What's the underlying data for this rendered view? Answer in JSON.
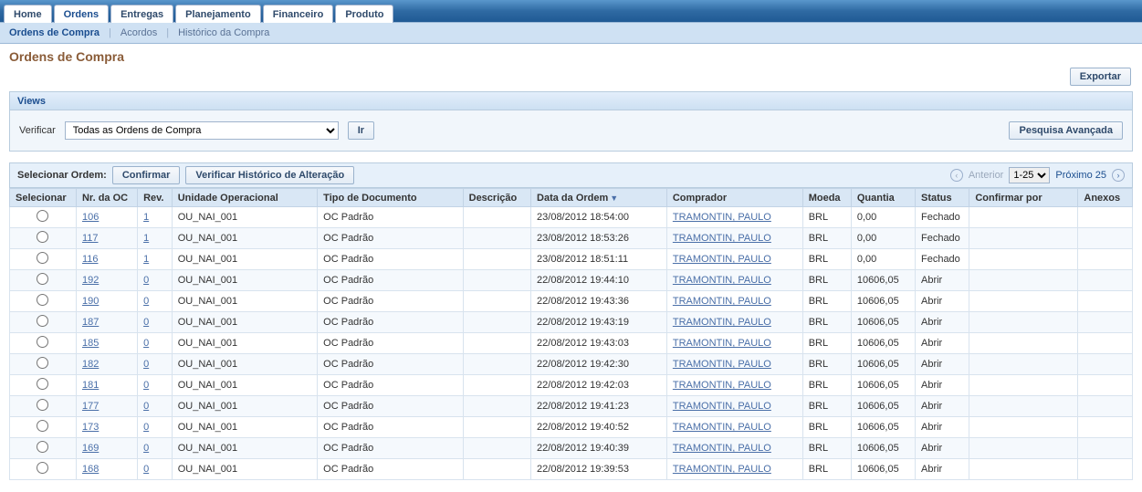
{
  "topTabs": [
    "Home",
    "Ordens",
    "Entregas",
    "Planejamento",
    "Financeiro",
    "Produto"
  ],
  "activeTab": 1,
  "subnav": {
    "current": "Ordens de Compra",
    "links": [
      "Acordos",
      "Histórico da Compra"
    ]
  },
  "pageTitle": "Ordens de Compra",
  "buttons": {
    "export": "Exportar",
    "go": "Ir",
    "advSearch": "Pesquisa Avançada",
    "confirm": "Confirmar",
    "histChange": "Verificar Histórico de Alteração"
  },
  "labels": {
    "views": "Views",
    "verify": "Verificar",
    "selectOrder": "Selecionar Ordem:",
    "prev": "Anterior",
    "next": "Próximo 25",
    "pageRange": "1-25"
  },
  "dropdown": {
    "selected": "Todas as Ordens de Compra"
  },
  "columns": {
    "selecionar": "Selecionar",
    "nrOc": "Nr. da OC",
    "rev": "Rev.",
    "unidade": "Unidade Operacional",
    "tipoDoc": "Tipo de Documento",
    "descricao": "Descrição",
    "dataOrdem": "Data da Ordem",
    "comprador": "Comprador",
    "moeda": "Moeda",
    "quantia": "Quantia",
    "status": "Status",
    "confirmarPor": "Confirmar por",
    "anexos": "Anexos"
  },
  "sortedCol": "dataOrdem",
  "rows": [
    {
      "oc": "106",
      "rev": "1",
      "unid": "OU_NAI_001",
      "tipo": "OC Padrão",
      "desc": "",
      "data": "23/08/2012 18:54:00",
      "comp": "TRAMONTIN, PAULO",
      "moeda": "BRL",
      "qtd": "0,00",
      "status": "Fechado",
      "conf": "",
      "anex": ""
    },
    {
      "oc": "117",
      "rev": "1",
      "unid": "OU_NAI_001",
      "tipo": "OC Padrão",
      "desc": "",
      "data": "23/08/2012 18:53:26",
      "comp": "TRAMONTIN, PAULO",
      "moeda": "BRL",
      "qtd": "0,00",
      "status": "Fechado",
      "conf": "",
      "anex": ""
    },
    {
      "oc": "116",
      "rev": "1",
      "unid": "OU_NAI_001",
      "tipo": "OC Padrão",
      "desc": "",
      "data": "23/08/2012 18:51:11",
      "comp": "TRAMONTIN, PAULO",
      "moeda": "BRL",
      "qtd": "0,00",
      "status": "Fechado",
      "conf": "",
      "anex": ""
    },
    {
      "oc": "192",
      "rev": "0",
      "unid": "OU_NAI_001",
      "tipo": "OC Padrão",
      "desc": "",
      "data": "22/08/2012 19:44:10",
      "comp": "TRAMONTIN, PAULO",
      "moeda": "BRL",
      "qtd": "10606,05",
      "status": "Abrir",
      "conf": "",
      "anex": ""
    },
    {
      "oc": "190",
      "rev": "0",
      "unid": "OU_NAI_001",
      "tipo": "OC Padrão",
      "desc": "",
      "data": "22/08/2012 19:43:36",
      "comp": "TRAMONTIN, PAULO",
      "moeda": "BRL",
      "qtd": "10606,05",
      "status": "Abrir",
      "conf": "",
      "anex": ""
    },
    {
      "oc": "187",
      "rev": "0",
      "unid": "OU_NAI_001",
      "tipo": "OC Padrão",
      "desc": "",
      "data": "22/08/2012 19:43:19",
      "comp": "TRAMONTIN, PAULO",
      "moeda": "BRL",
      "qtd": "10606,05",
      "status": "Abrir",
      "conf": "",
      "anex": ""
    },
    {
      "oc": "185",
      "rev": "0",
      "unid": "OU_NAI_001",
      "tipo": "OC Padrão",
      "desc": "",
      "data": "22/08/2012 19:43:03",
      "comp": "TRAMONTIN, PAULO",
      "moeda": "BRL",
      "qtd": "10606,05",
      "status": "Abrir",
      "conf": "",
      "anex": ""
    },
    {
      "oc": "182",
      "rev": "0",
      "unid": "OU_NAI_001",
      "tipo": "OC Padrão",
      "desc": "",
      "data": "22/08/2012 19:42:30",
      "comp": "TRAMONTIN, PAULO",
      "moeda": "BRL",
      "qtd": "10606,05",
      "status": "Abrir",
      "conf": "",
      "anex": ""
    },
    {
      "oc": "181",
      "rev": "0",
      "unid": "OU_NAI_001",
      "tipo": "OC Padrão",
      "desc": "",
      "data": "22/08/2012 19:42:03",
      "comp": "TRAMONTIN, PAULO",
      "moeda": "BRL",
      "qtd": "10606,05",
      "status": "Abrir",
      "conf": "",
      "anex": ""
    },
    {
      "oc": "177",
      "rev": "0",
      "unid": "OU_NAI_001",
      "tipo": "OC Padrão",
      "desc": "",
      "data": "22/08/2012 19:41:23",
      "comp": "TRAMONTIN, PAULO",
      "moeda": "BRL",
      "qtd": "10606,05",
      "status": "Abrir",
      "conf": "",
      "anex": ""
    },
    {
      "oc": "173",
      "rev": "0",
      "unid": "OU_NAI_001",
      "tipo": "OC Padrão",
      "desc": "",
      "data": "22/08/2012 19:40:52",
      "comp": "TRAMONTIN, PAULO",
      "moeda": "BRL",
      "qtd": "10606,05",
      "status": "Abrir",
      "conf": "",
      "anex": ""
    },
    {
      "oc": "169",
      "rev": "0",
      "unid": "OU_NAI_001",
      "tipo": "OC Padrão",
      "desc": "",
      "data": "22/08/2012 19:40:39",
      "comp": "TRAMONTIN, PAULO",
      "moeda": "BRL",
      "qtd": "10606,05",
      "status": "Abrir",
      "conf": "",
      "anex": ""
    },
    {
      "oc": "168",
      "rev": "0",
      "unid": "OU_NAI_001",
      "tipo": "OC Padrão",
      "desc": "",
      "data": "22/08/2012 19:39:53",
      "comp": "TRAMONTIN, PAULO",
      "moeda": "BRL",
      "qtd": "10606,05",
      "status": "Abrir",
      "conf": "",
      "anex": ""
    }
  ]
}
